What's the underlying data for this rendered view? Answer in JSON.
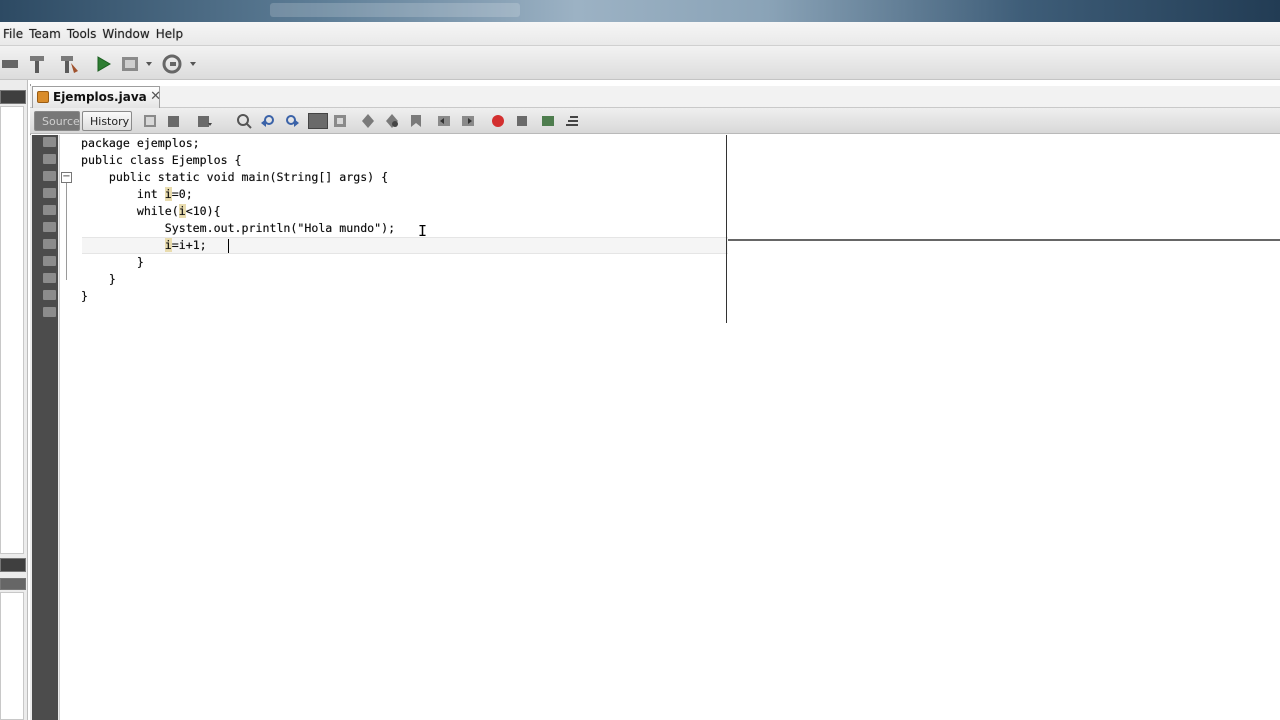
{
  "window": {
    "title": ""
  },
  "menu": {
    "items": [
      "File",
      "Team",
      "Tools",
      "Window",
      "Help"
    ]
  },
  "toolbar": {
    "icons": [
      "build-icon",
      "clean-build-icon",
      "run-icon",
      "debug-icon",
      "profile-icon"
    ]
  },
  "editor": {
    "file_tab": "Ejemplos.java",
    "close_glyph": "✕",
    "mode_tabs": {
      "source": "Source",
      "history": "History"
    },
    "cursor_glyph": "I",
    "code": {
      "l1": "package ejemplos;",
      "l2": "public class Ejemplos {",
      "l3": "    public static void main(String[] args) {",
      "l4_a": "        int ",
      "l4_var": "i",
      "l4_b": "=0;",
      "l5_a": "        while(",
      "l5_var": "i",
      "l5_b": "<10){",
      "l6": "            System.out.println(\"Hola mundo\");",
      "l7_pre": "            ",
      "l7_var": "i",
      "l7_b": "=i+1;",
      "l8": "        }",
      "l9": "    }",
      "l10": "}"
    }
  },
  "colors": {
    "accent": "#e9dcae",
    "gutter": "#4c4c4c"
  }
}
